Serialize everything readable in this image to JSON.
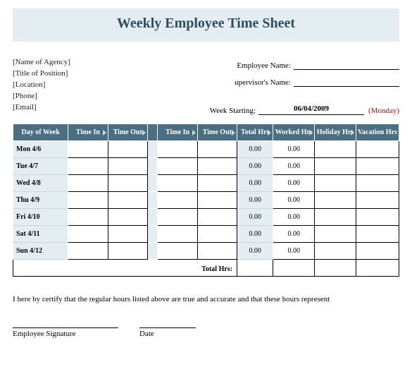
{
  "title": "Weekly Employee Time Sheet",
  "agency": {
    "name": "[Name of Agency]",
    "position": "[Title of Position]",
    "location": "[Location]",
    "phone": "[Phone]",
    "email": "[Email]"
  },
  "fields": {
    "employee_name_label": "Employee Name:",
    "supervisor_label": "upervisor's Name:",
    "week_starting_label": "Week Starting:",
    "week_starting_value": "06/04/2009",
    "week_starting_day": "(Monday)"
  },
  "columns": {
    "day": "Day of Week",
    "time_in1": "Time In",
    "time_out1": "Time Out",
    "time_in2": "Time In",
    "time_out2": "Time Out",
    "total_hrs": "Total Hrs",
    "worked_hrs": "Worked Hrs",
    "holiday_hrs": "Holiday Hrs",
    "vacation_hrs": "Vacation Hrs"
  },
  "rows": [
    {
      "day": "Mon 4/6",
      "total": "0.00",
      "worked": "0.00"
    },
    {
      "day": "Tue 4/7",
      "total": "0.00",
      "worked": "0.00"
    },
    {
      "day": "Wed 4/8",
      "total": "0.00",
      "worked": "0.00"
    },
    {
      "day": "Thu 4/9",
      "total": "0.00",
      "worked": "0.00"
    },
    {
      "day": "Fri 4/10",
      "total": "0.00",
      "worked": "0.00"
    },
    {
      "day": "Sat 4/11",
      "total": "0.00",
      "worked": "0.00"
    },
    {
      "day": "Sun 4/12",
      "total": "0.00",
      "worked": "0.00"
    }
  ],
  "totals_label": "Total Hrs:",
  "certification": "I here by certify that the regular hours listed above are true and accurate and that these hours represent",
  "signature_label": "Employee Signature",
  "date_label": "Date"
}
